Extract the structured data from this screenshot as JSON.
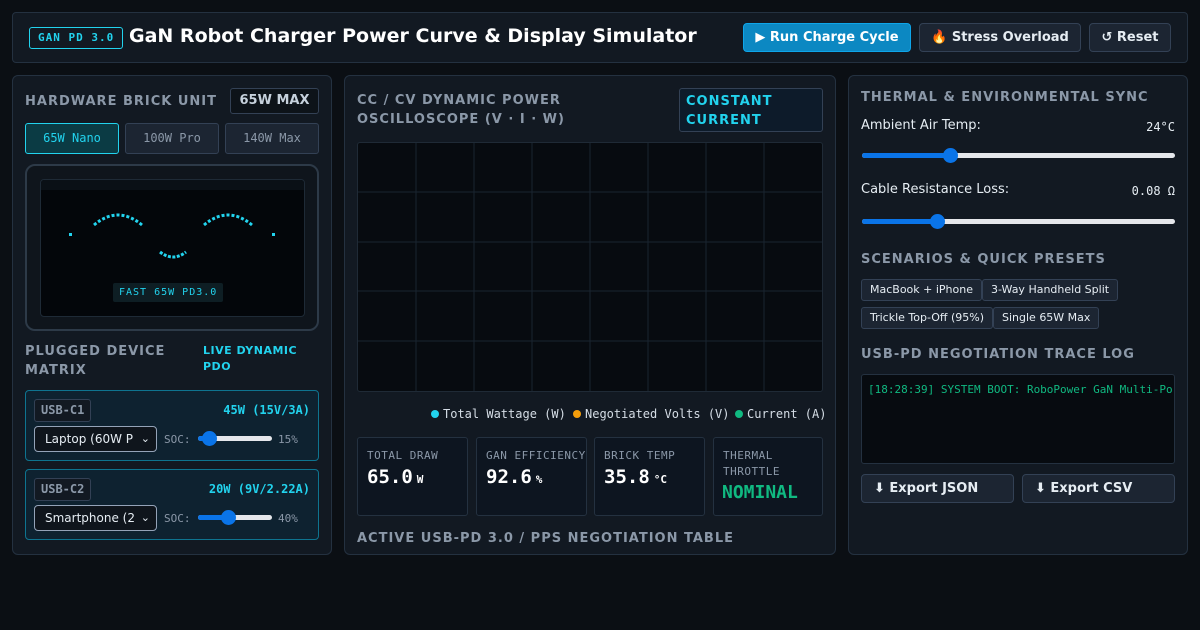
{
  "header": {
    "badge": "GAN PD 3.0",
    "title": "GaN Robot Charger Power Curve & Display Simulator",
    "run_label": "▶ Run Charge Cycle",
    "stress_label": "🔥 Stress Overload",
    "reset_label": "↺ Reset"
  },
  "hardware": {
    "title": "HARDWARE BRICK UNIT",
    "max_label": "65W MAX",
    "units": [
      "65W Nano",
      "100W Pro",
      "140W Max"
    ],
    "active_unit": "65W Nano",
    "display_text": "FAST 65W PD3.0"
  },
  "devices": {
    "title_line1": "PLUGGED DEVICE",
    "title_line2": "MATRIX",
    "live_line1": "LIVE DYNAMIC",
    "live_line2": "PDO",
    "ports": [
      {
        "name": "USB-C1",
        "power": "45W (15V/3A)",
        "device": "Laptop (60W P",
        "soc_label": "SOC:",
        "soc": 15,
        "soc_text": "15%"
      },
      {
        "name": "USB-C2",
        "power": "20W (9V/2.22A)",
        "device": "Smartphone (2",
        "soc_label": "SOC:",
        "soc": 40,
        "soc_text": "40%"
      }
    ]
  },
  "oscilloscope": {
    "title_line1": "CC / CV DYNAMIC POWER",
    "title_line2": "OSCILLOSCOPE (V · I · W)",
    "mode_line1": "CONSTANT",
    "mode_line2": "CURRENT",
    "legend": [
      {
        "label": "Total Wattage (W)",
        "color": "#22d3ee"
      },
      {
        "label": "Negotiated Volts (V)",
        "color": "#f59e0b"
      },
      {
        "label": "Current (A)",
        "color": "#10b981"
      }
    ]
  },
  "stats": {
    "total_draw_label": "TOTAL DRAW",
    "total_draw": "65.0",
    "total_draw_unit": "W",
    "efficiency_label": "GAN EFFICIENCY",
    "efficiency": "92.6",
    "efficiency_unit": "%",
    "temp_label": "BRICK TEMP",
    "temp": "35.8",
    "temp_unit": "°C",
    "throttle_label_line1": "THERMAL",
    "throttle_label_line2": "THROTTLE",
    "throttle": "NOMINAL"
  },
  "pps_table_title": "ACTIVE USB-PD 3.0 / PPS NEGOTIATION TABLE",
  "thermal": {
    "title": "THERMAL & ENVIRONMENTAL SYNC",
    "ambient_label": "Ambient Air Temp:",
    "ambient_value": "24°C",
    "ambient_level": 0.28,
    "cable_label": "Cable Resistance Loss:",
    "cable_value": "0.08 Ω",
    "cable_level": 0.24
  },
  "scenarios": {
    "title": "SCENARIOS & QUICK PRESETS",
    "presets": [
      "MacBook + iPhone",
      "3-Way Handheld Split",
      "Trickle Top-Off (95%)",
      "Single 65W Max"
    ]
  },
  "trace": {
    "title": "USB-PD NEGOTIATION TRACE LOG",
    "log": "[18:28:39] SYSTEM BOOT: RoboPower GaN Multi-Po",
    "export_json": "⬇ Export JSON",
    "export_csv": "⬇ Export CSV"
  }
}
